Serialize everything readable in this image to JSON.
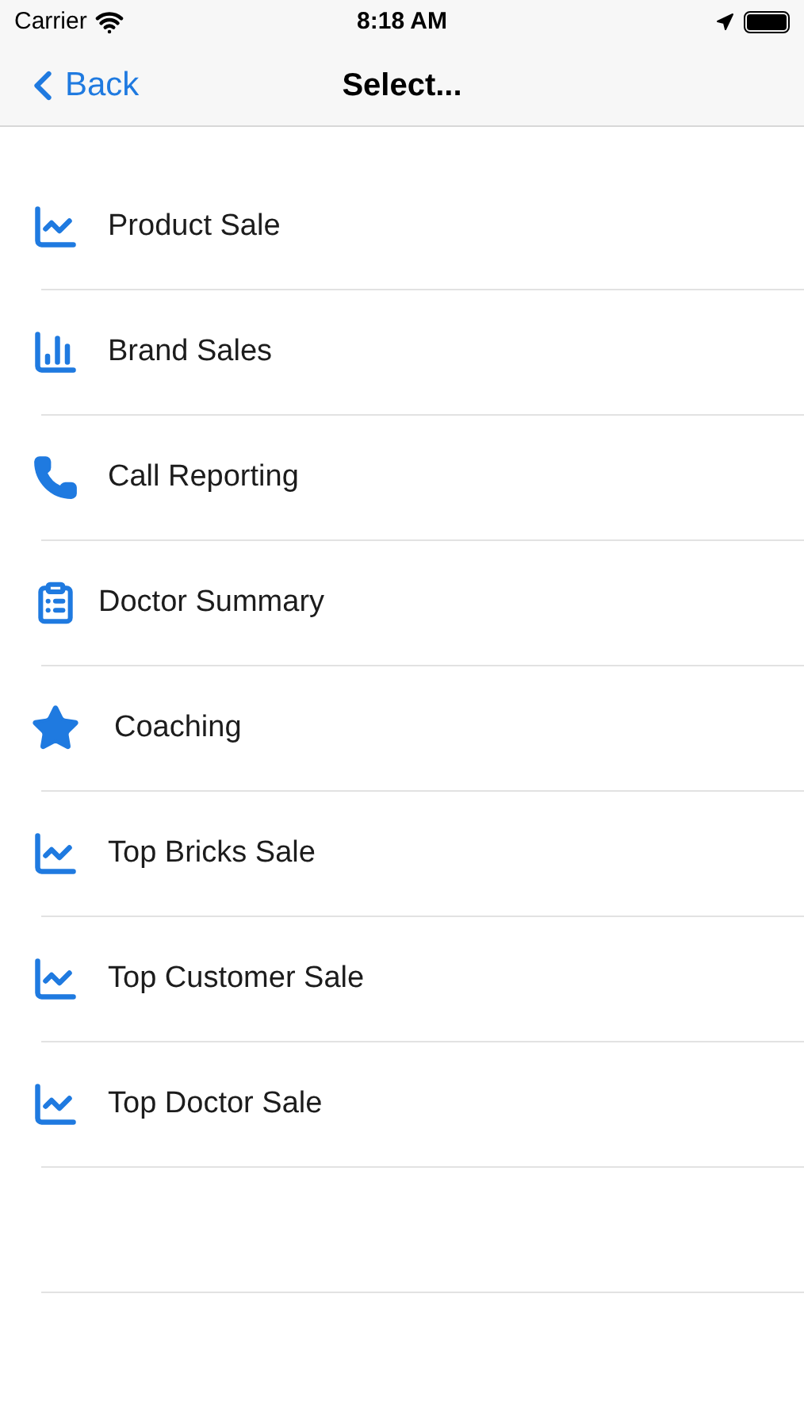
{
  "status_bar": {
    "carrier": "Carrier",
    "time": "8:18 AM"
  },
  "nav": {
    "back": "Back",
    "title": "Select..."
  },
  "items": [
    {
      "kind": "trend",
      "label": "Product Sale"
    },
    {
      "kind": "bars",
      "label": "Brand Sales"
    },
    {
      "kind": "phone",
      "label": "Call Reporting"
    },
    {
      "kind": "clipboard",
      "label": "Doctor Summary"
    },
    {
      "kind": "star",
      "label": "Coaching"
    },
    {
      "kind": "trend",
      "label": "Top Bricks Sale"
    },
    {
      "kind": "trend",
      "label": "Top Customer Sale"
    },
    {
      "kind": "trend",
      "label": "Top Doctor Sale"
    }
  ]
}
